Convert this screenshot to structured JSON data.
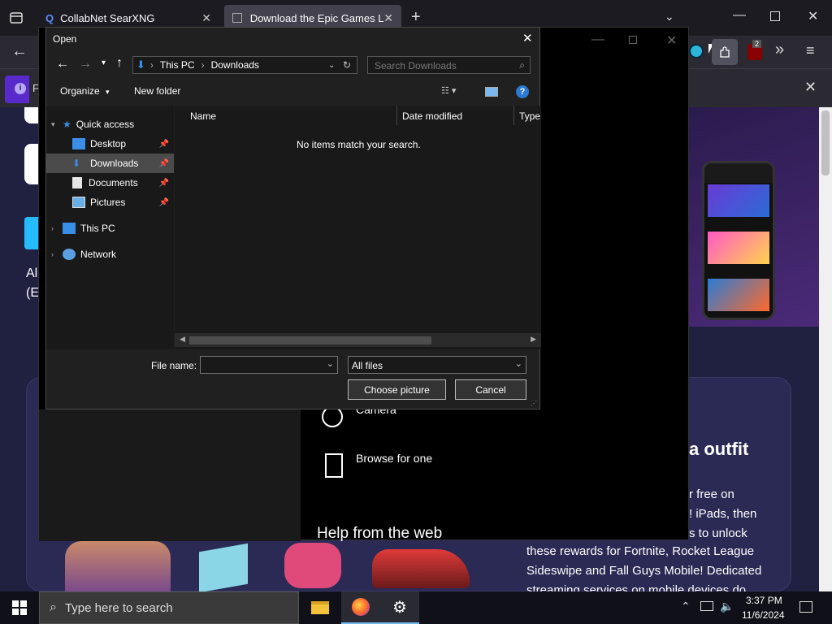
{
  "browser": {
    "tabs": [
      {
        "title": "CollabNet SearXNG"
      },
      {
        "title": "Download the Epic Games Laun"
      }
    ],
    "notif_text": "Fi",
    "extension_badge": "2"
  },
  "page": {
    "hero_fragment_1": "Al",
    "hero_fragment_2": "(E",
    "outfit_heading": "a outfit",
    "para_lines": [
      "r free on",
      "! iPads, then",
      "s to unlock",
      "these rewards for Fortnite, Rocket League",
      "Sideswipe and Fall Guys Mobile! Dedicated",
      "streaming services on mobile devices do"
    ]
  },
  "settings_window": {
    "camera_label": "Camera",
    "browse_label": "Browse for one",
    "help_heading": "Help from the web"
  },
  "dialog": {
    "title": "Open",
    "breadcrumb": [
      "This PC",
      "Downloads"
    ],
    "search_placeholder": "Search Downloads",
    "organize_label": "Organize",
    "new_folder_label": "New folder",
    "columns": [
      "Name",
      "Date modified",
      "Type"
    ],
    "empty_message": "No items match your search.",
    "nav": {
      "quick_access": "Quick access",
      "items": [
        "Desktop",
        "Downloads",
        "Documents",
        "Pictures"
      ],
      "this_pc": "This PC",
      "network": "Network"
    },
    "file_name_label": "File name:",
    "file_name_value": "",
    "file_type_value": "All files",
    "choose_button": "Choose picture",
    "cancel_button": "Cancel"
  },
  "taskbar": {
    "search_placeholder": "Type here to search",
    "time": "3:37 PM",
    "date": "11/6/2024"
  }
}
